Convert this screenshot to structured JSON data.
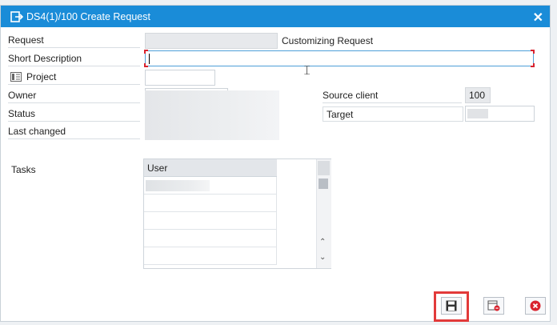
{
  "window": {
    "title": "DS4(1)/100 Create Request",
    "close_label": "✕"
  },
  "form": {
    "request_label": "Request",
    "request_type": "Customizing Request",
    "short_description_label": "Short Description",
    "short_description_value": "",
    "project_label": "Project",
    "owner_label": "Owner",
    "status_label": "Status",
    "last_changed_label": "Last changed",
    "source_client_label": "Source client",
    "source_client_value": "100",
    "target_label": "Target",
    "tasks_label": "Tasks"
  },
  "tasks_table": {
    "header": "User",
    "row_count": 5
  },
  "buttons": {
    "save": "save-icon",
    "delete": "delete-icon",
    "cancel": "cancel-icon"
  },
  "colors": {
    "title_bar": "#1a8cd8",
    "highlight": "#e23a3a",
    "cancel_red": "#d9232e"
  }
}
